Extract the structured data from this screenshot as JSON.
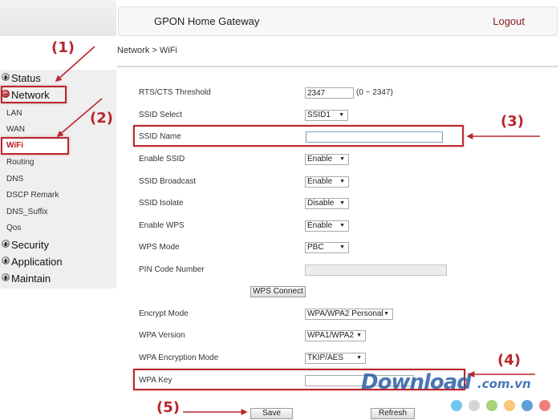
{
  "header": {
    "title": "GPON Home Gateway",
    "logout_label": "Logout"
  },
  "breadcrumb": "Network > WiFi",
  "sidebar": {
    "groups": [
      {
        "label": "Status",
        "icon": "plus-icon",
        "expanded": false
      },
      {
        "label": "Network",
        "icon": "minus-icon",
        "expanded": true
      },
      {
        "label": "Security",
        "icon": "plus-icon",
        "expanded": false
      },
      {
        "label": "Application",
        "icon": "plus-icon",
        "expanded": false
      },
      {
        "label": "Maintain",
        "icon": "plus-icon",
        "expanded": false
      }
    ],
    "network_items": [
      {
        "label": "LAN"
      },
      {
        "label": "WAN"
      },
      {
        "label": "WiFi",
        "active": true
      },
      {
        "label": "Routing"
      },
      {
        "label": "DNS"
      },
      {
        "label": "DSCP Remark"
      },
      {
        "label": "DNS_Suffix"
      },
      {
        "label": "Qos"
      }
    ]
  },
  "form": {
    "rts_cts": {
      "label": "RTS/CTS Threshold",
      "value": "2347",
      "hint": "(0 ~ 2347)"
    },
    "ssid_select": {
      "label": "SSID Select",
      "value": "SSID1"
    },
    "ssid_name": {
      "label": "SSID Name",
      "value": ""
    },
    "enable_ssid": {
      "label": "Enable SSID",
      "value": "Enable"
    },
    "ssid_broadcast": {
      "label": "SSID Broadcast",
      "value": "Enable"
    },
    "ssid_isolate": {
      "label": "SSID Isolate",
      "value": "Disable"
    },
    "enable_wps": {
      "label": "Enable WPS",
      "value": "Enable"
    },
    "wps_mode": {
      "label": "WPS Mode",
      "value": "PBC"
    },
    "pin_code": {
      "label": "PIN Code Number",
      "value": ""
    },
    "wps_connect_label": "WPS Connect",
    "encrypt_mode": {
      "label": "Encrypt Mode",
      "value": "WPA/WPA2 Personal"
    },
    "wpa_version": {
      "label": "WPA Version",
      "value": "WPA1/WPA2"
    },
    "wpa_encryption_mode": {
      "label": "WPA Encryption Mode",
      "value": "TKIP/AES"
    },
    "wpa_key": {
      "label": "WPA Key",
      "value": ""
    },
    "save_label": "Save",
    "refresh_label": "Refresh",
    "dropdown_arrow": "▼"
  },
  "annotations": {
    "step1": "(1)",
    "step2": "(2)",
    "step3": "(3)",
    "step4": "(4)",
    "step5": "(5)",
    "color": "#b8262c"
  },
  "watermark": {
    "text": "Download",
    "suffix": ".com.vn",
    "dot_colors": [
      "#6fc8ef",
      "#d5d5d5",
      "#a6d37a",
      "#f8c77a",
      "#5c9fd6",
      "#ef7d7d"
    ]
  }
}
